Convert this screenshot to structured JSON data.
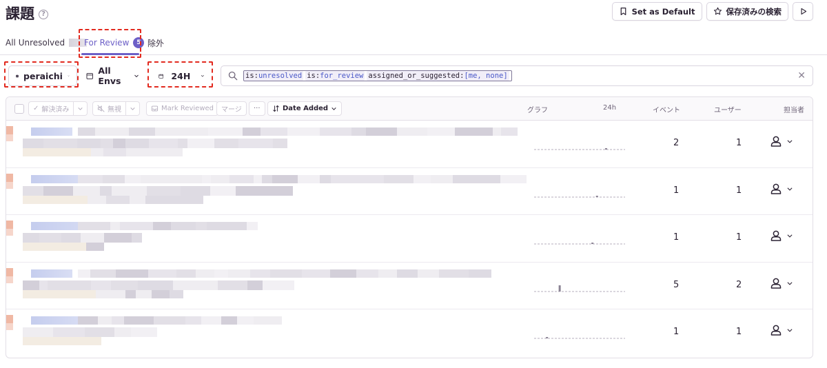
{
  "header": {
    "title": "課題",
    "set_default_label": "Set as Default",
    "saved_search_label": "保存済みの検索"
  },
  "tabs": [
    {
      "label": "All Unresolved"
    },
    {
      "label": "For Review",
      "count": "5"
    },
    {
      "label": "除外"
    }
  ],
  "filters": {
    "project": "peraichi",
    "envs": "All Envs",
    "period": "24H"
  },
  "search": {
    "tokens": [
      {
        "key": "is:",
        "value": "unresolved"
      },
      {
        "key": "is:",
        "value": "for_review"
      },
      {
        "key": "assigned_or_suggested:",
        "value": "[me, none]"
      }
    ]
  },
  "toolbar": {
    "resolve": "解決済み",
    "ignore": "無視",
    "mark_reviewed": "Mark Reviewed",
    "merge": "マージ",
    "more": "···",
    "sort": "Date Added"
  },
  "columns": {
    "graph": "グラフ",
    "period": "24h",
    "events": "イベント",
    "users": "ユーザー",
    "assignee": "担当者"
  },
  "rows": [
    {
      "events": "2",
      "users": "1",
      "spike": 0.78
    },
    {
      "events": "1",
      "users": "1",
      "spike": 0.68
    },
    {
      "events": "1",
      "users": "1",
      "spike": 0.63
    },
    {
      "events": "5",
      "users": "2",
      "spike": 0.27
    },
    {
      "events": "1",
      "users": "1",
      "spike": 0.13
    }
  ],
  "colors": {
    "accent": "#6c5fc7",
    "highlight": "#e2291e"
  }
}
